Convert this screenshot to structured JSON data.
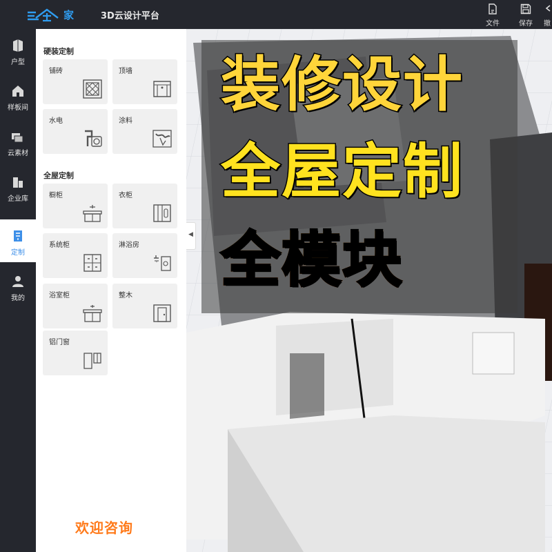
{
  "header": {
    "logo_text": "家",
    "platform_title": "3D云设计平台",
    "actions": [
      {
        "label": "文件",
        "icon": "file-icon"
      },
      {
        "label": "保存",
        "icon": "save-icon"
      },
      {
        "label": "撤",
        "icon": "undo-icon"
      }
    ]
  },
  "rail": {
    "items": [
      {
        "label": "户型",
        "icon": "floorplan-icon"
      },
      {
        "label": "样板间",
        "icon": "house-icon"
      },
      {
        "label": "云素材",
        "icon": "cloud-materials-icon"
      },
      {
        "label": "企业库",
        "icon": "enterprise-library-icon"
      },
      {
        "label": "定制",
        "icon": "custom-icon",
        "active": true
      },
      {
        "label": "我的",
        "icon": "user-icon"
      }
    ]
  },
  "panel": {
    "section1_title": "硬装定制",
    "section1_items": [
      {
        "label": "铺砖",
        "icon": "tile-icon"
      },
      {
        "label": "顶墙",
        "icon": "ceiling-wall-icon"
      },
      {
        "label": "水电",
        "icon": "plumbing-electric-icon"
      },
      {
        "label": "涂料",
        "icon": "paint-icon"
      }
    ],
    "section2_title": "全屋定制",
    "section2_items": [
      {
        "label": "橱柜",
        "icon": "kitchen-cabinet-icon"
      },
      {
        "label": "衣柜",
        "icon": "wardrobe-icon"
      },
      {
        "label": "系统柜",
        "icon": "system-cabinet-icon"
      },
      {
        "label": "淋浴房",
        "icon": "shower-room-icon"
      },
      {
        "label": "浴室柜",
        "icon": "bathroom-cabinet-icon"
      },
      {
        "label": "整木",
        "icon": "whole-wood-icon"
      },
      {
        "label": "铝门窗",
        "icon": "aluminum-door-window-icon"
      }
    ],
    "welcome": "欢迎咨询"
  },
  "promo": {
    "line1": "装修设计",
    "line2": "全屋定制",
    "line3": "全模块"
  },
  "colors": {
    "chrome": "#25272e",
    "accent_blue": "#3d8fe8",
    "card_bg": "#f0f0f0",
    "welcome_orange": "#ff7a1a",
    "promo_yellow": "#ffe21f",
    "promo_orange": "#f46b17"
  }
}
